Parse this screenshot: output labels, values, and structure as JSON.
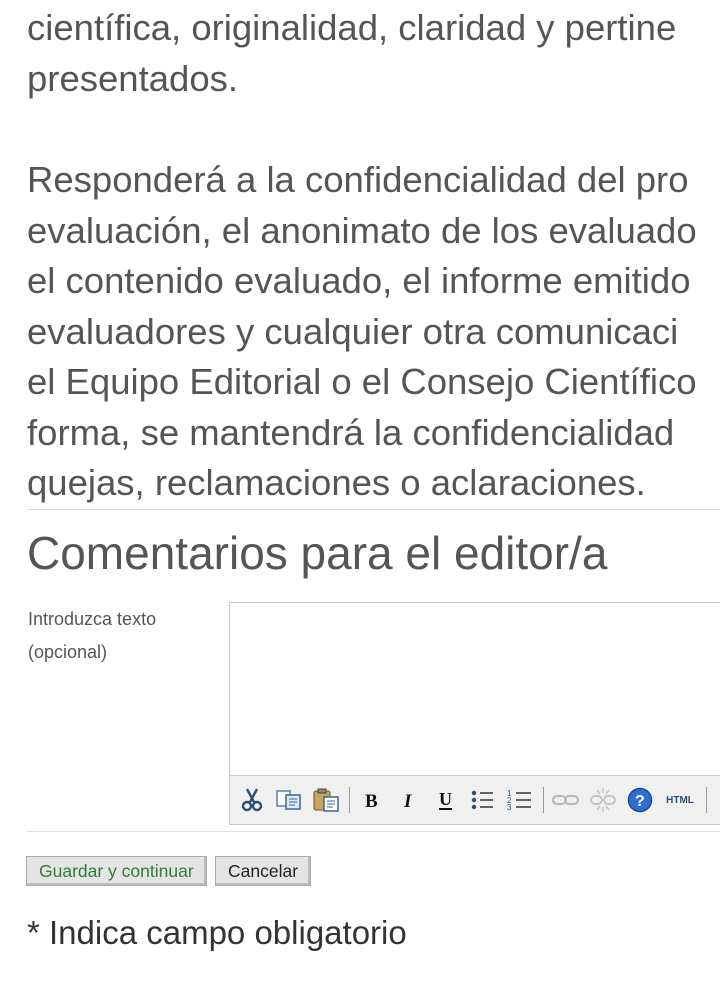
{
  "paragraph_1": {
    "lines": [
      "científica, originalidad, claridad y pertine",
      "presentados."
    ]
  },
  "paragraph_2": {
    "lines": [
      "Responderá a la confidencialidad del pro",
      "evaluación, el anonimato de los evaluado",
      "el contenido evaluado, el informe emitido",
      "evaluadores y cualquier otra comunicaci",
      "el Equipo Editorial o el Consejo Científico",
      "forma, se mantendrá la confidencialidad",
      "quejas, reclamaciones o aclaraciones."
    ]
  },
  "section": {
    "title": "Comentarios para el editor/a",
    "field_label_line1": "Introduzca texto",
    "field_label_line2": "(opcional)",
    "editor_value": ""
  },
  "toolbar": {
    "buttons": [
      "cut-icon",
      "copy-icon",
      "paste-icon",
      "bold-icon",
      "italic-icon",
      "underline-icon",
      "bulleted-list-icon",
      "numbered-list-icon",
      "link-icon",
      "unlink-icon",
      "help-icon",
      "html-icon"
    ],
    "html_label": "HTML"
  },
  "actions": {
    "save_label": "Guardar y continuar",
    "cancel_label": "Cancelar"
  },
  "footer": {
    "required_note": "* Indica campo obligatorio"
  },
  "colors": {
    "text": "#555555",
    "save_text": "#2e7d32",
    "button_bg": "#e4e4e4"
  }
}
